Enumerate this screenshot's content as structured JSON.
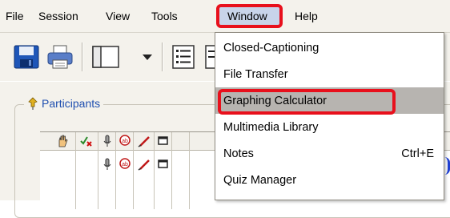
{
  "menubar": {
    "items": [
      "File",
      "Session",
      "View",
      "Tools",
      "Window",
      "Help"
    ]
  },
  "toolbar": {
    "icons": [
      "save-icon",
      "print-icon",
      "layout-icon",
      "chevron-down-icon",
      "list-icon",
      "list-icon-2"
    ]
  },
  "panel": {
    "participants_label": "Participants",
    "grid_header_icons": [
      "raise-hand-icon",
      "check-x-icon",
      "mic-icon",
      "chat-icon",
      "pen-icon",
      "screen-icon"
    ]
  },
  "window_menu": {
    "items": [
      {
        "label": "Closed-Captioning",
        "shortcut": ""
      },
      {
        "label": "File Transfer",
        "shortcut": ""
      },
      {
        "label": "Graphing Calculator",
        "shortcut": ""
      },
      {
        "label": "Multimedia Library",
        "shortcut": ""
      },
      {
        "label": "Notes",
        "shortcut": "Ctrl+E"
      },
      {
        "label": "Quiz Manager",
        "shortcut": ""
      }
    ],
    "selected": "Graphing Calculator"
  },
  "colors": {
    "highlight_outline": "#e8101c",
    "link_blue": "#1f4fb0",
    "selected_bg": "#b7b4b0"
  }
}
